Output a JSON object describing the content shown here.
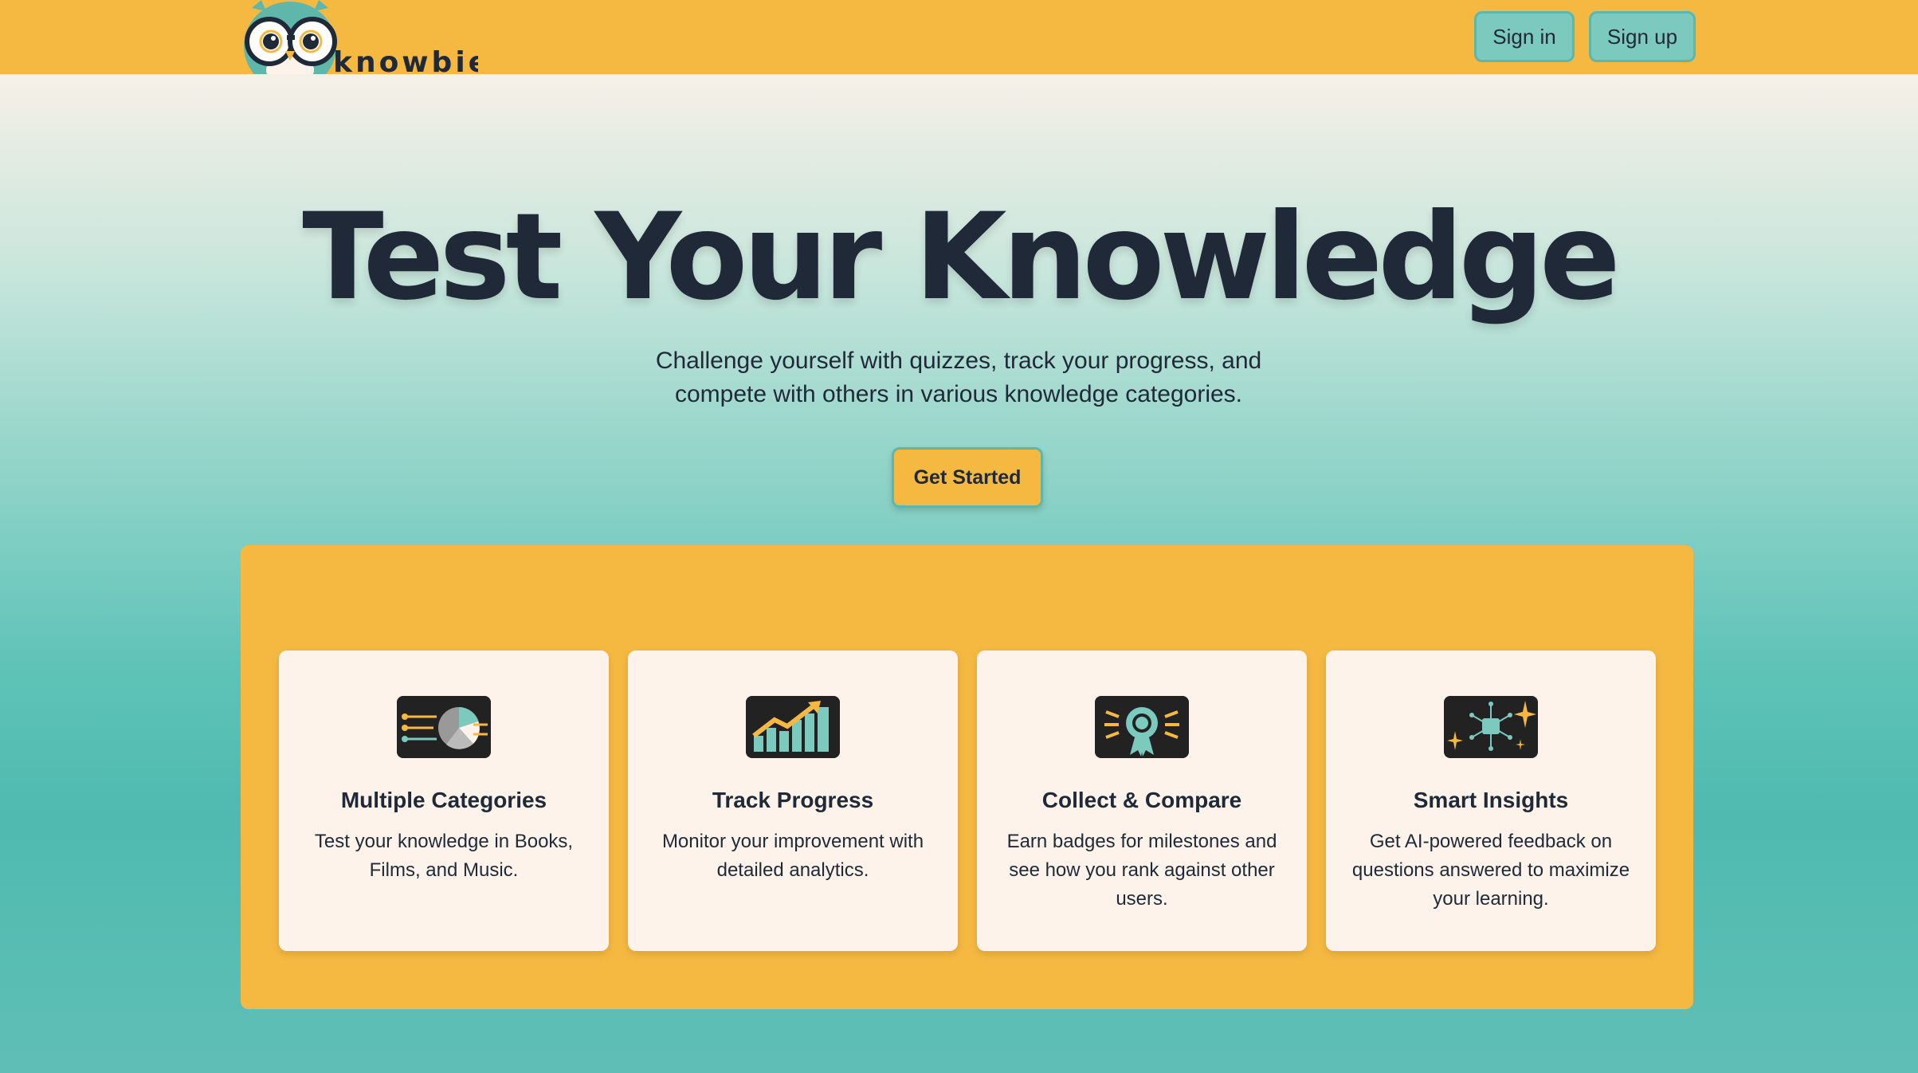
{
  "brand": {
    "name": "knowbie"
  },
  "nav": {
    "sign_in": "Sign in",
    "sign_up": "Sign up"
  },
  "hero": {
    "title": "Test Your Knowledge",
    "subtitle": "Challenge yourself with quizzes, track your progress, and compete with others in various knowledge categories.",
    "cta": "Get Started"
  },
  "features": [
    {
      "icon": "categories-icon",
      "title": "Multiple Categories",
      "description": "Test your knowledge in Books, Films, and Music."
    },
    {
      "icon": "progress-chart-icon",
      "title": "Track Progress",
      "description": "Monitor your improvement with detailed analytics."
    },
    {
      "icon": "badge-icon",
      "title": "Collect & Compare",
      "description": "Earn badges for milestones and see how you rank against other users."
    },
    {
      "icon": "ai-insights-icon",
      "title": "Smart Insights",
      "description": "Get AI-powered feedback on questions answered to maximize your learning."
    }
  ],
  "colors": {
    "header": "#f5b942",
    "accent_teal": "#7cc9be",
    "card_bg": "#fdf3ea",
    "text_dark": "#1f2937"
  }
}
